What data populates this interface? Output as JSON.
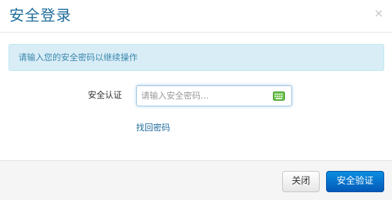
{
  "dialog": {
    "title": "安全登录",
    "close_icon": "×",
    "alert_text": "请输入您的安全密码以继续操作",
    "form": {
      "label": "安全认证",
      "input_value": "",
      "input_placeholder": "请输入安全密码...",
      "keyboard_icon": "keyboard-icon",
      "forgot_link": "找回密码"
    },
    "footer": {
      "close_label": "关闭",
      "submit_label": "安全验证"
    }
  },
  "colors": {
    "title": "#1f6e9c",
    "alert_bg": "#d9edf7",
    "alert_text": "#3a87ad",
    "link": "#1e6b9b",
    "primary_button": "#0a6fd0",
    "keyboard_icon": "#5cb84a"
  }
}
